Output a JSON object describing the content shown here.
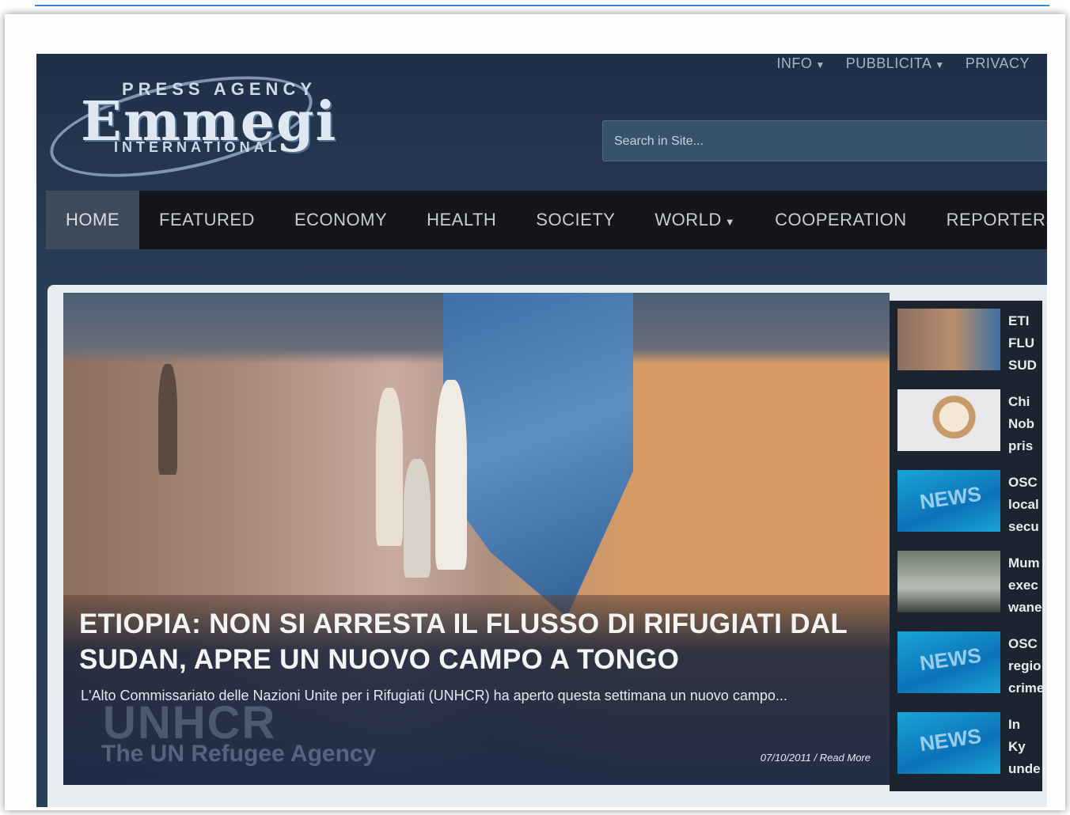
{
  "logo": {
    "line1": "PRESS AGENCY",
    "name": "Emmegi",
    "line2": "INTERNATIONAL"
  },
  "top_links": [
    {
      "label": "INFO",
      "has_dropdown": true
    },
    {
      "label": "PUBBLICITA",
      "has_dropdown": true
    },
    {
      "label": "PRIVACY",
      "has_dropdown": false
    }
  ],
  "search": {
    "placeholder": "Search in Site..."
  },
  "nav": [
    {
      "label": "HOME",
      "active": true
    },
    {
      "label": "FEATURED"
    },
    {
      "label": "ECONOMY"
    },
    {
      "label": "HEALTH"
    },
    {
      "label": "SOCIETY"
    },
    {
      "label": "WORLD",
      "has_dropdown": true
    },
    {
      "label": "COOPERATION"
    },
    {
      "label": "REPORTERS"
    }
  ],
  "hero": {
    "headline": "ETIOPIA: NON SI ARRESTA IL FLUSSO DI RIFUGIATI DAL SUDAN, APRE UN NUOVO CAMPO A TONGO",
    "excerpt": "L'Alto Commissariato delle Nazioni Unite per i Rifugiati (UNHCR) ha aperto questa settimana un nuovo campo...",
    "watermark_line1": "UNHCR",
    "watermark_line2": "The UN Refugee Agency",
    "meta": "07/10/2011 / Read More"
  },
  "side_items": [
    {
      "text": "ETI FLU SUD",
      "thumb": "photo"
    },
    {
      "text": "Chi Nob pris",
      "thumb": "face"
    },
    {
      "text": "OSC local secu",
      "thumb": "news"
    },
    {
      "text": "Mum exec wane",
      "thumb": "room"
    },
    {
      "text": "OSC regio crime",
      "thumb": "news"
    },
    {
      "text": "In Ky unde",
      "thumb": "news"
    }
  ],
  "thumb_news_label": "NEWS"
}
